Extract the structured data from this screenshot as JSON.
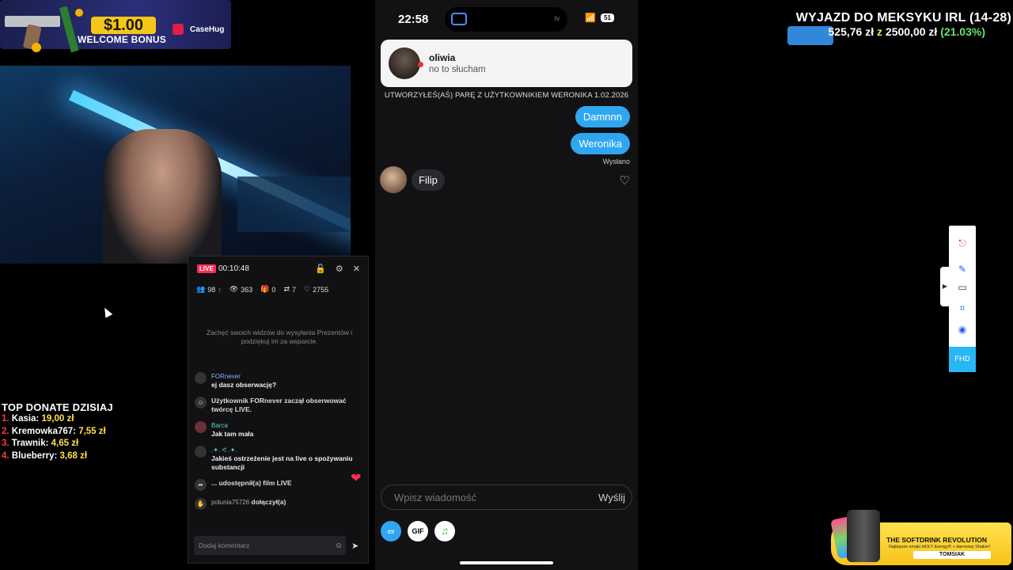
{
  "bonus": {
    "amount": "$1.00",
    "label": "WELCOME BONUS",
    "brand": "CaseHug"
  },
  "live": {
    "badge": "LIVE",
    "time": "00:10:48",
    "stats": {
      "users": "98",
      "views": "363",
      "gifts": "0",
      "shares": "7",
      "likes": "2755"
    },
    "gifts_hint": "Zachęć swoich widzów do wysyłania Prezentów i podziękuj im za wsparcie.",
    "chat": [
      {
        "name": "FORnever",
        "text": "ej dasz obserwację?"
      },
      {
        "system": "Użytkownik FORnever zaczął obserwować twórcę LIVE."
      },
      {
        "name": "Barca",
        "text": "Jak tam mała"
      },
      {
        "name": ".✦. ᕙ .✦.",
        "text": "Jakieś ostrzeżenie jest na live o spożywaniu substancji"
      },
      {
        "system": "... udostępnił(a) film LIVE"
      },
      {
        "name": "polunia75726",
        "system": "dołączył(a)"
      }
    ],
    "comment_placeholder": "Dodaj komentarz"
  },
  "donate": {
    "title": "TOP DONATE DZISIAJ",
    "rows": [
      {
        "n": "1.",
        "name": "Kasia:",
        "value": "19,00 zł"
      },
      {
        "n": "2.",
        "name": "Kremowka767:",
        "value": "7,55 zł"
      },
      {
        "n": "3.",
        "name": "Trawnik:",
        "value": "4,65 zł"
      },
      {
        "n": "4.",
        "name": "Blueberry:",
        "value": "3,68 zł"
      }
    ]
  },
  "phone": {
    "time": "22:58",
    "island_label": "tv",
    "battery": "51",
    "notification": {
      "name": "oliwia",
      "text": "no to słucham"
    },
    "pair_info": "UTWORZYŁEŚ(AŚ) PARĘ Z UŻYTKOWNIKIEM WERONIKA 1.02.2026",
    "out_messages": [
      "Damnnn",
      "Weronika"
    ],
    "sent_label": "Wysłano",
    "in_message": "Filip",
    "input_placeholder": "Wpisz wiadomość",
    "send_label": "Wyślij",
    "gif_label": "GIF"
  },
  "goal": {
    "title": "WYJAZD DO MEKSYKU IRL (14-28)",
    "current": "525,76 zł",
    "z": "z",
    "target": "2500,00 zł",
    "percent": "(21.03%)",
    "progress_fraction": 0.2103
  },
  "sidebar": {
    "fhd": "FHD"
  },
  "ad": {
    "title": "THE SOFTDRINK REVOLUTION",
    "sub": "Najlepsze smaki HOLY Energy® + darmowy Shaker!",
    "code": "TOMSIAK"
  }
}
